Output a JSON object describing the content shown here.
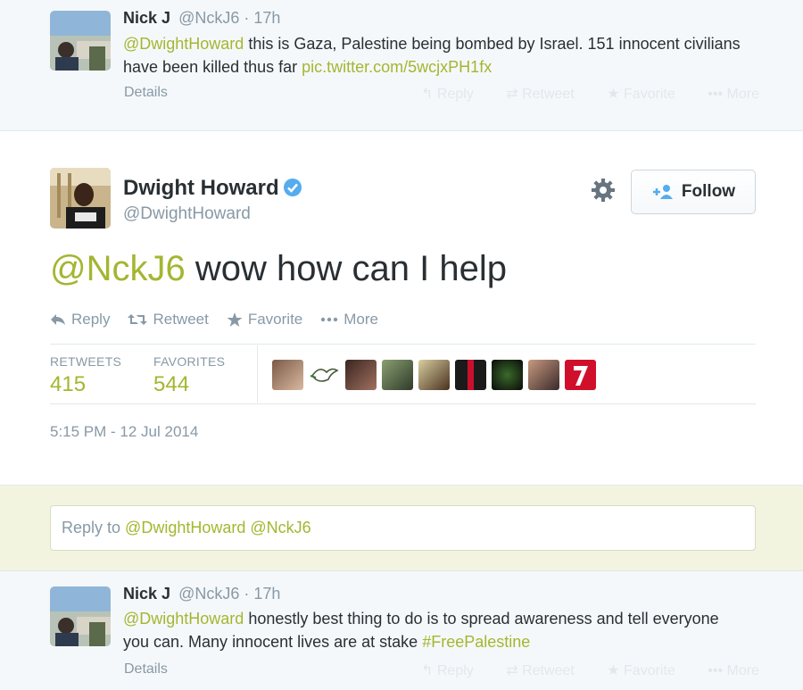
{
  "tweet_top": {
    "name": "Nick J",
    "handle_time": "@NckJ6 · 17h",
    "mention": "@DwightHoward",
    "text": " this is Gaza, Palestine being bombed by Israel. 151 innocent civilians have been killed thus far ",
    "link": "pic.twitter.com/5wcjxPH1fx",
    "details": "Details",
    "actions": [
      "Reply",
      "Retweet",
      "Favorite",
      "More"
    ]
  },
  "main_tweet": {
    "name": "Dwight Howard",
    "handle": "@DwightHoward",
    "follow_label": "Follow",
    "mention": "@NckJ6",
    "text": " wow how can I help",
    "actions": {
      "reply": "Reply",
      "retweet": "Retweet",
      "favorite": "Favorite",
      "more": "More"
    },
    "stats": {
      "retweets_label": "RETWEETS",
      "retweets": "415",
      "favorites_label": "FAVORITES",
      "favorites": "544"
    },
    "timestamp": "5:15 PM - 12 Jul 2014"
  },
  "reply_box": {
    "prefix": "Reply to ",
    "mentions": "@DwightHoward @NckJ6"
  },
  "tweet_bottom": {
    "name": "Nick J",
    "handle_time": "@NckJ6 · 17h",
    "mention": "@DwightHoward",
    "text": " honestly best thing to do is to spread awareness and tell everyone you can. Many innocent lives are at stake ",
    "hashtag": "#FreePalestine",
    "details": "Details",
    "actions": [
      "Reply",
      "Retweet",
      "Favorite",
      "More"
    ]
  },
  "colors": {
    "link": "#a4b630",
    "muted": "#8899a6",
    "verified": "#55acee"
  },
  "icons": [
    "reply-icon",
    "retweet-icon",
    "favorite-icon",
    "more-icon",
    "gear-icon",
    "add-user-icon",
    "verified-icon"
  ]
}
